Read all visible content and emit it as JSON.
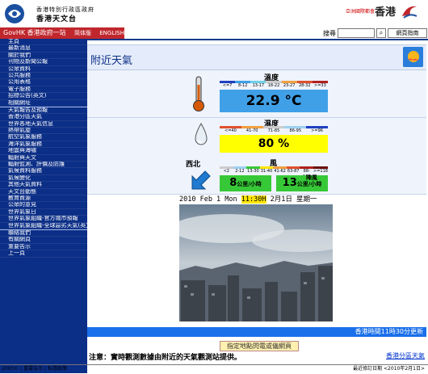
{
  "header": {
    "org_line1": "香港特別行政區政府",
    "org_line2": "香港天文台",
    "brand_slogan": "亞洲國際都會",
    "brand_text": "香港"
  },
  "navbar": {
    "gov_label": "GovHK 香港政府一站通",
    "lang_traditional": "简体版",
    "lang_english": "ENGLISH",
    "search_label": "搜尋",
    "search_placeholder": "",
    "web_index_label": "網頁指南"
  },
  "sidebar": {
    "items": [
      "主頁",
      "最新消息",
      "關於我們",
      "刊物及新聞公報",
      "公眾資料",
      "公共服務",
      "公用表格",
      "電子服務",
      "招標公告(英文)",
      "相關網址",
      "天氣報告及預報",
      "香港分區天氣",
      "世界各地天氣信息",
      "熱帶氣旋",
      "航空氣象服務",
      "海洋氣象服務",
      "地震與海嘯",
      "輻射與天文",
      "輻射監測、評價及防護",
      "氣候資料服務",
      "氣候變化",
      "其他天氣資料",
      "天文台動態",
      "教育資源",
      "公眾的意見",
      "世界氣象日",
      "世界氣象組織-官方城市預報",
      "世界氣象組織-全球惡劣天氣(英文)",
      "聯絡我們",
      "有關網頁",
      "重要告示",
      "上一頁"
    ]
  },
  "page": {
    "title": "附近天氣",
    "temperature": {
      "label": "溫度",
      "value": "22.9 °C",
      "scale": [
        "<=7",
        "8-12",
        "13-17",
        "18-22",
        "23-27",
        "28-32",
        ">=33"
      ]
    },
    "humidity": {
      "label": "濕度",
      "value": "80 %",
      "scale": [
        "<=40",
        "41-70",
        "71-85",
        "86-95",
        ">=96"
      ]
    },
    "wind": {
      "label": "風",
      "direction": "西北",
      "scale": [
        "<2",
        "2-12",
        "13-30",
        "31-40",
        "41-62",
        "63-87",
        "88-117",
        ">=118"
      ],
      "mean_value": "8",
      "mean_unit": "公里/小時",
      "gust_label": "陣風",
      "gust_value": "13",
      "gust_unit": "公里/小時"
    },
    "camera_caption_date": "2010 Feb 1 Mon",
    "camera_caption_time": "11:30H",
    "camera_caption_cn": "2月1日 星期一",
    "update_text": "香港時間11時30分更新",
    "select_station_label": "指定地點閃電或儀網頁",
    "note": "注意：實時觀測數據由附近的天氣觀測站提供。",
    "note_link": "香港分區天氣"
  },
  "footer": {
    "left": "2003© | 重要告示 | 私隱政策",
    "right": "最近修訂日期 <2010年2月1日>"
  },
  "colors": {
    "sidebar_bg": "#0b2e86",
    "gov_red": "#c0272d",
    "temp_box": "#3fa0e8",
    "humidity_box": "#ffff00",
    "wind_box": "#37c837",
    "update_bar": "#1a6fea"
  }
}
